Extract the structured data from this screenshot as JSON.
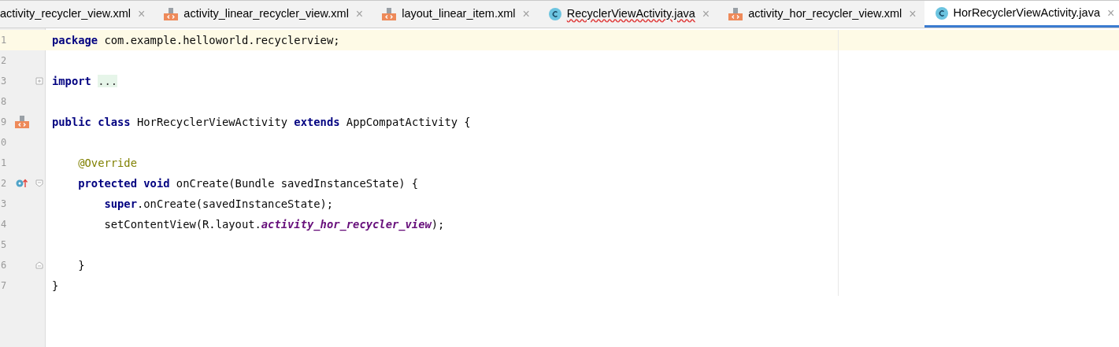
{
  "tabs": [
    {
      "label": "activity_recycler_view.xml",
      "kind": "plain",
      "selected": false,
      "error": false
    },
    {
      "label": "activity_linear_recycler_view.xml",
      "kind": "xml",
      "selected": false,
      "error": false
    },
    {
      "label": "layout_linear_item.xml",
      "kind": "xml",
      "selected": false,
      "error": false
    },
    {
      "label": "RecyclerViewActivity.java",
      "kind": "class",
      "selected": false,
      "error": true
    },
    {
      "label": "activity_hor_recycler_view.xml",
      "kind": "xml",
      "selected": false,
      "error": false
    },
    {
      "label": "HorRecyclerViewActivity.java",
      "kind": "class",
      "selected": true,
      "error": false
    }
  ],
  "close_glyph": "×",
  "lines": [
    {
      "number": "1",
      "current": true,
      "tokens": [
        {
          "kind": "keyword",
          "text": "package"
        },
        {
          "kind": "plain",
          "text": " com.example.helloworld.recyclerview;"
        }
      ]
    },
    {
      "number": "2",
      "current": false
    },
    {
      "number": "3",
      "current": false,
      "fold": {
        "kind": "expand"
      },
      "tokens": [
        {
          "kind": "keyword",
          "text": "import "
        },
        {
          "kind": "folded",
          "text": "..."
        }
      ]
    },
    {
      "number": "8",
      "current": false
    },
    {
      "number": "9",
      "current": false,
      "marker": {
        "kind": "layout"
      },
      "tokens": [
        {
          "kind": "keyword",
          "text": "public class"
        },
        {
          "kind": "plain",
          "text": " HorRecyclerViewActivity "
        },
        {
          "kind": "keyword",
          "text": "extends"
        },
        {
          "kind": "plain",
          "text": " AppCompatActivity {"
        }
      ]
    },
    {
      "number": "0",
      "current": false
    },
    {
      "number": "1",
      "current": false,
      "tokens": [
        {
          "kind": "annotation",
          "text": "    @Override"
        }
      ]
    },
    {
      "number": "2",
      "current": false,
      "marker": {
        "kind": "override"
      },
      "fold": {
        "kind": "start"
      },
      "tokens": [
        {
          "kind": "keyword",
          "text": "    protected void"
        },
        {
          "kind": "plain",
          "text": " onCreate(Bundle savedInstanceState) {"
        }
      ]
    },
    {
      "number": "3",
      "current": false,
      "tokens": [
        {
          "kind": "keyword",
          "text": "        super"
        },
        {
          "kind": "plain",
          "text": ".onCreate(savedInstanceState);"
        }
      ]
    },
    {
      "number": "4",
      "current": false,
      "tokens": [
        {
          "kind": "plain",
          "text": "        setContentView(R.layout."
        },
        {
          "kind": "field",
          "text": "activity_hor_recycler_view"
        },
        {
          "kind": "plain",
          "text": ");"
        }
      ]
    },
    {
      "number": "5",
      "current": false
    },
    {
      "number": "6",
      "current": false,
      "fold": {
        "kind": "end"
      },
      "tokens": [
        {
          "kind": "plain",
          "text": "    }"
        }
      ]
    },
    {
      "number": "7",
      "current": false,
      "tokens": [
        {
          "kind": "plain",
          "text": "}"
        }
      ]
    }
  ]
}
